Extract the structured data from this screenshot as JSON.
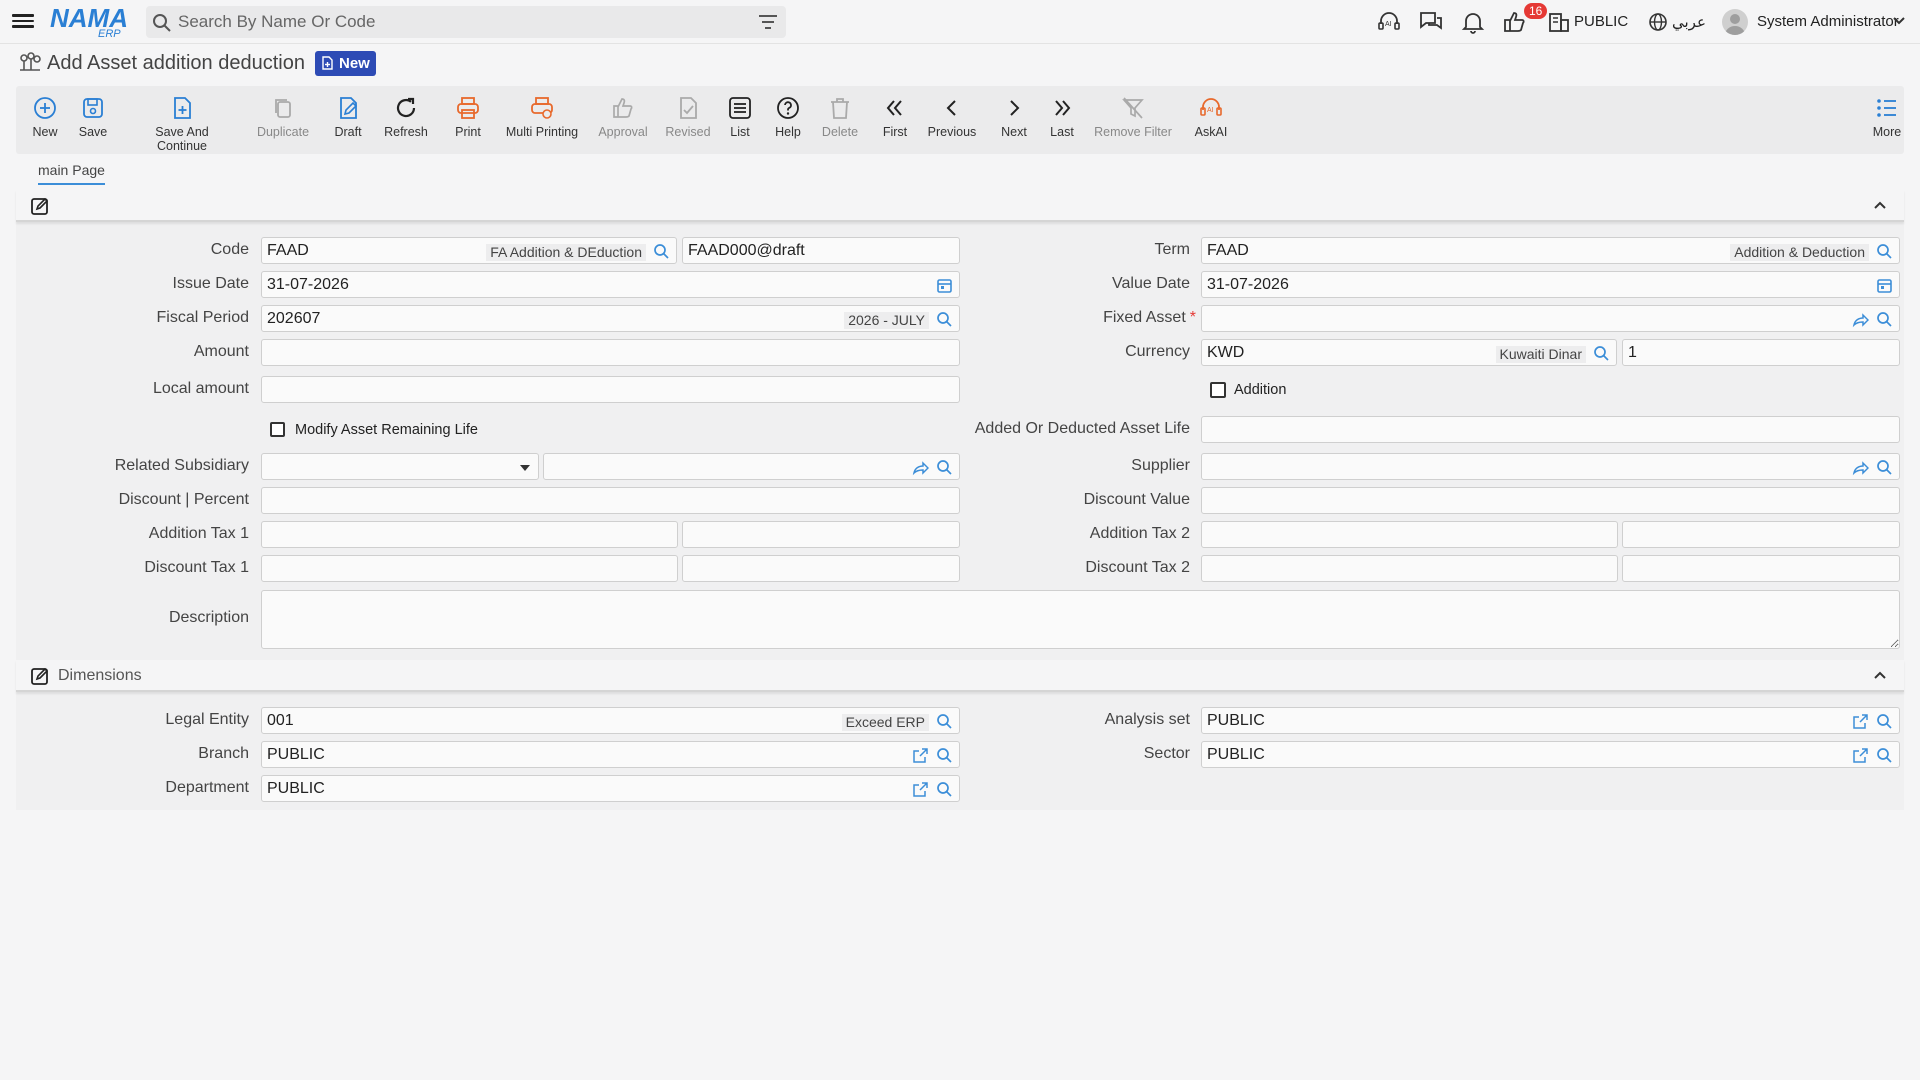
{
  "app": {
    "logo_text": "NAMA",
    "logo_sub": "ERP"
  },
  "search": {
    "placeholder": "Search By Name Or Code"
  },
  "top": {
    "notif_count": "16",
    "legal": "PUBLIC",
    "lang": "عربي",
    "user": "System Administrator"
  },
  "page": {
    "title": "Add Asset addition deduction",
    "status": "New"
  },
  "toolbar": {
    "new": "New",
    "save": "Save",
    "save_continue": "Save And Continue",
    "duplicate": "Duplicate",
    "draft": "Draft",
    "refresh": "Refresh",
    "print": "Print",
    "multi_print": "Multi Printing",
    "approval": "Approval",
    "revised": "Revised",
    "list": "List",
    "help": "Help",
    "delete": "Delete",
    "first": "First",
    "previous": "Previous",
    "next": "Next",
    "last": "Last",
    "remove_filter": "Remove Filter",
    "askai": "AskAI",
    "more": "More"
  },
  "tabs": {
    "main": "main Page"
  },
  "form": {
    "code_label": "Code",
    "code_value": "FAAD",
    "code_desc": "FA Addition & DEduction",
    "code_number": "FAAD000@draft",
    "term_label": "Term",
    "term_value": "FAAD",
    "term_desc": "Addition & Deduction",
    "issue_date_label": "Issue Date",
    "issue_date": "31-07-2026",
    "value_date_label": "Value Date",
    "value_date": "31-07-2026",
    "fiscal_label": "Fiscal Period",
    "fiscal_value": "202607",
    "fiscal_desc": "2026 - JULY",
    "fixed_asset_label": "Fixed Asset",
    "amount_label": "Amount",
    "currency_label": "Currency",
    "currency_value": "KWD",
    "currency_desc": "Kuwaiti Dinar",
    "currency_rate": "1",
    "local_amount_label": "Local amount",
    "addition_label": "Addition",
    "modify_life_label": "Modify Asset Remaining Life",
    "added_life_label": "Added Or Deducted Asset Life",
    "related_sub_label": "Related Subsidiary",
    "supplier_label": "Supplier",
    "discount_pct_label": "Discount | Percent",
    "discount_value_label": "Discount Value",
    "add_tax1_label": "Addition Tax 1",
    "add_tax2_label": "Addition Tax 2",
    "disc_tax1_label": "Discount Tax 1",
    "disc_tax2_label": "Discount Tax 2",
    "description_label": "Description"
  },
  "dimensions": {
    "title": "Dimensions",
    "legal_label": "Legal Entity",
    "legal_value": "001",
    "legal_desc": "Exceed ERP",
    "analysis_label": "Analysis set",
    "analysis_value": "PUBLIC",
    "branch_label": "Branch",
    "branch_value": "PUBLIC",
    "sector_label": "Sector",
    "sector_value": "PUBLIC",
    "department_label": "Department",
    "department_value": "PUBLIC"
  },
  "colors": {
    "accent": "#2d4bb5",
    "link": "#3c8ed8",
    "print": "#e8692c",
    "required": "#e53935"
  }
}
